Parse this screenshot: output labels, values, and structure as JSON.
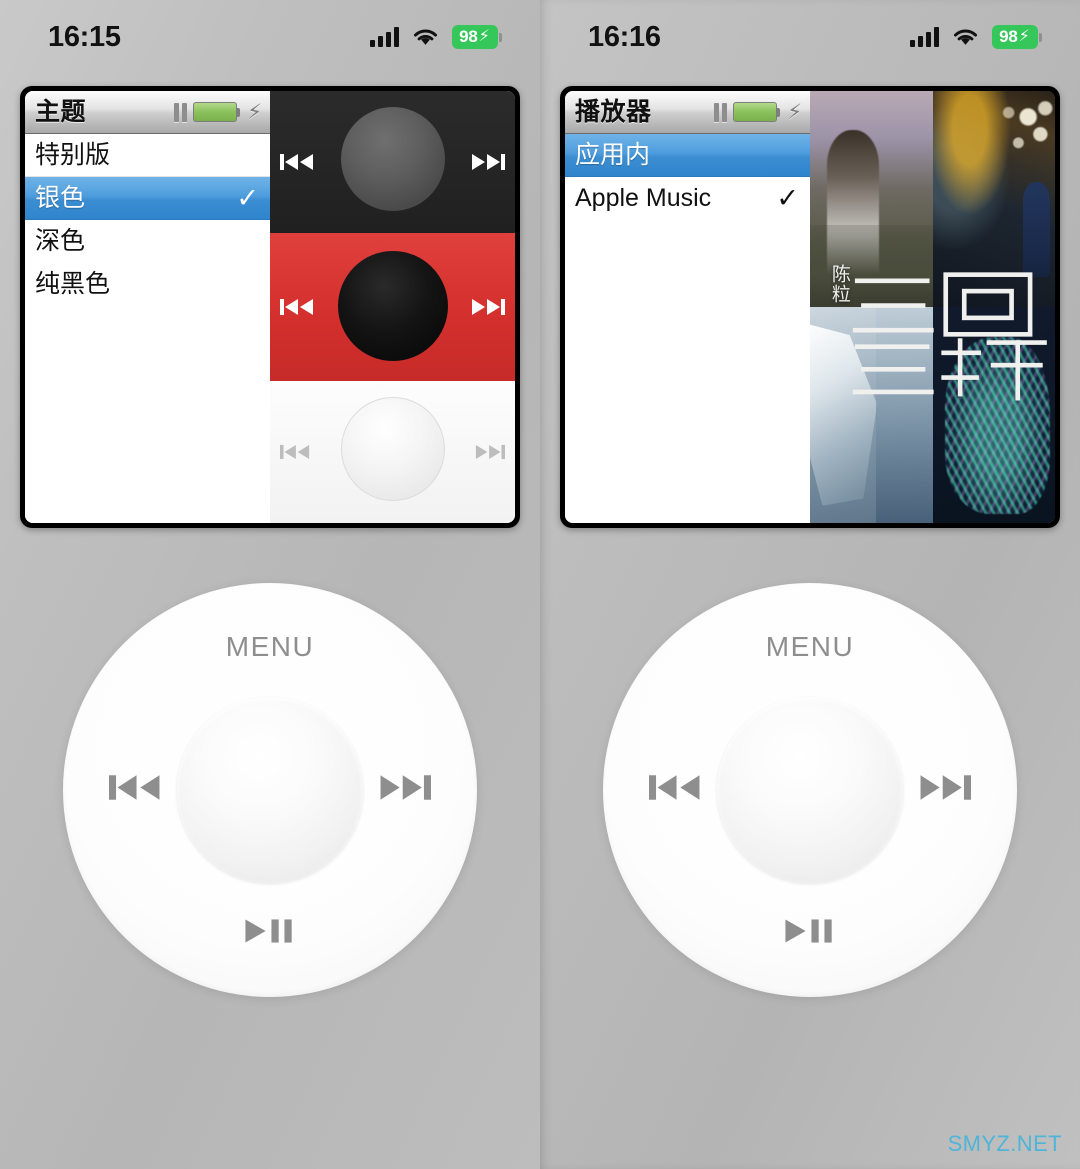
{
  "watermark": "SMYZ.NET",
  "panels": [
    {
      "id": "left",
      "statusbar": {
        "time": "16:15",
        "cellular_icon": "cellular-signal-icon",
        "wifi_icon": "wifi-icon",
        "battery_percent": "98",
        "battery_charging_icon": "lightning-bolt-icon",
        "battery_color": "#35c759"
      },
      "screen": {
        "titlebar": {
          "title": "主题",
          "pause_icon": "pause-icon",
          "battery_icon": "battery-icon",
          "charging_icon": "lightning-bolt-icon"
        },
        "menu_items": [
          {
            "label": "特别版",
            "selected": false,
            "checked": false
          },
          {
            "label": "银色",
            "selected": true,
            "checked": true
          },
          {
            "label": "深色",
            "selected": false,
            "checked": false
          },
          {
            "label": "纯黑色",
            "selected": false,
            "checked": false
          }
        ],
        "theme_previews": [
          {
            "name": "dark-theme-preview",
            "body_color": "#202020",
            "wheel_color": "#5e5e5e"
          },
          {
            "name": "red-theme-preview",
            "body_color": "#d4302d",
            "wheel_color": "#0a0a0a"
          },
          {
            "name": "white-theme-preview",
            "body_color": "#f7f7f7",
            "wheel_color": "#f0f0f0"
          }
        ]
      },
      "clickwheel": {
        "menu_label": "MENU",
        "prev_icon": "previous-track-icon",
        "next_icon": "next-track-icon",
        "playpause_icon": "play-pause-icon",
        "wheel_color": "#ffffff"
      }
    },
    {
      "id": "right",
      "statusbar": {
        "time": "16:16",
        "cellular_icon": "cellular-signal-icon",
        "wifi_icon": "wifi-icon",
        "battery_percent": "98",
        "battery_charging_icon": "lightning-bolt-icon",
        "battery_color": "#35c759"
      },
      "screen": {
        "titlebar": {
          "title": "播放器",
          "pause_icon": "pause-icon",
          "battery_icon": "battery-icon",
          "charging_icon": "lightning-bolt-icon"
        },
        "menu_items": [
          {
            "label": "应用内",
            "selected": true,
            "checked": false
          },
          {
            "label": "Apple Music",
            "selected": false,
            "checked": true
          }
        ],
        "album_art": {
          "artist": "陈粒",
          "title_chars": [
            "三",
            "回",
            "三",
            "游"
          ]
        }
      },
      "clickwheel": {
        "menu_label": "MENU",
        "prev_icon": "previous-track-icon",
        "next_icon": "next-track-icon",
        "playpause_icon": "play-pause-icon",
        "wheel_color": "#ffffff"
      }
    }
  ]
}
